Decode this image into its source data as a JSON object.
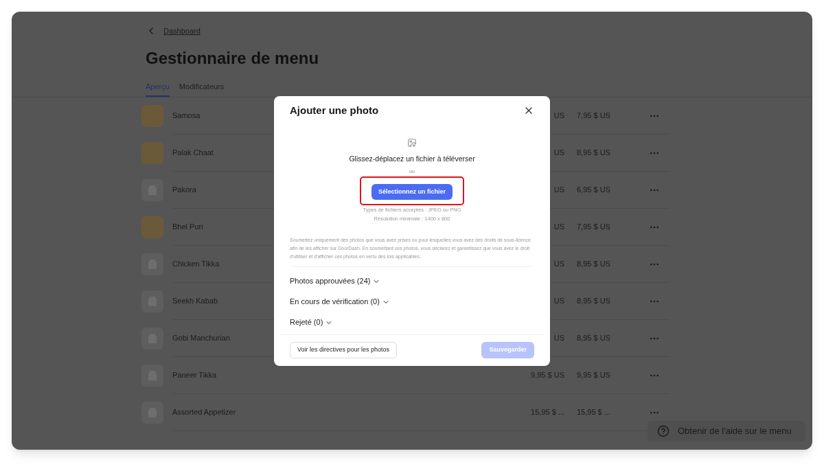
{
  "breadcrumb": {
    "label": "Dashboard"
  },
  "title": "Gestionnaire de menu",
  "tabs": [
    {
      "label": "Aperçu",
      "selected": true
    },
    {
      "label": "Modificateurs",
      "selected": false
    }
  ],
  "items": [
    {
      "name": "Samosa",
      "kind": "photo",
      "price_1": "US",
      "price_2": "7,95 $ US"
    },
    {
      "name": "Palak Chaat",
      "kind": "photo",
      "price_1": "US",
      "price_2": "8,95 $ US"
    },
    {
      "name": "Pakora",
      "kind": "placeholder",
      "price_1": "US",
      "price_2": "6,95 $ US"
    },
    {
      "name": "Bhel Puri",
      "kind": "photo",
      "price_1": "US",
      "price_2": "7,95 $ US"
    },
    {
      "name": "Chicken Tikka",
      "kind": "placeholder",
      "price_1": "US",
      "price_2": "8,95 $ US"
    },
    {
      "name": "Seekh Kabab",
      "kind": "placeholder",
      "price_1": "US",
      "price_2": "8,95 $ US"
    },
    {
      "name": "Gobi Manchurian",
      "kind": "placeholder",
      "price_1": "US",
      "price_2": "8,95 $ US"
    },
    {
      "name": "Paneer Tikka",
      "kind": "placeholder",
      "price_1": "9,95 $ US",
      "price_2": "9,95 $ US"
    },
    {
      "name": "Assorted Appetizer",
      "kind": "placeholder",
      "price_1": "15,95 $ ...",
      "price_2": "15,95 $ ..."
    }
  ],
  "help_button": {
    "label": "Obtenir de l'aide sur le menu"
  },
  "dialog": {
    "title": "Ajouter une photo",
    "drop_text": "Glissez-déplacez un fichier à téléverser",
    "or_text": "ou",
    "select_button": {
      "label": "Sélectionnez un fichier",
      "highlighted": true
    },
    "file_types": "Types de fichiers acceptés : JPEG ou PNG",
    "min_resolution": "Résolution minimale : 1400 x 800",
    "disclaimer": "Soumettez uniquement des photos que vous avez prises ou pour lesquelles vous avez des droits de sous-licence afin de les afficher sur DoorDash. En soumettant ces photos, vous déclarez et garantissez que vous avez le droit d'utiliser et d'afficher ces photos en vertu des lois applicables.",
    "sections": [
      {
        "label": "Photos approuvées (24)",
        "expanded": false
      },
      {
        "label": "En cours de vérification (0)",
        "expanded": false
      },
      {
        "label": "Rejeté (0)",
        "expanded": false
      }
    ],
    "guidelines_button": {
      "label": "Voir les directives pour les photos"
    },
    "save_button": {
      "label": "Sauvegarder",
      "disabled": true
    }
  }
}
